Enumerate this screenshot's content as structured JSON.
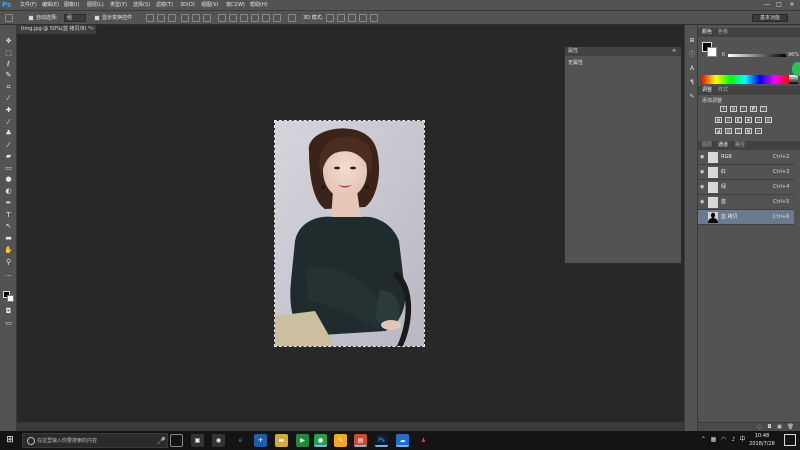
{
  "app": {
    "logo": "Ps"
  },
  "menu": {
    "items": [
      "文件(F)",
      "编辑(E)",
      "图像(I)",
      "图层(L)",
      "类型(Y)",
      "选择(S)",
      "滤镜(T)",
      "3D(D)",
      "视图(V)",
      "窗口(W)",
      "帮助(H)"
    ],
    "min": "—",
    "max": "□",
    "close": "✕"
  },
  "options": {
    "auto_select_label": "自动选择:",
    "auto_select_value": "组",
    "show_transform_label": "显示变换控件",
    "mode_3d_label": "3D 模式:",
    "workspace": "基本功能"
  },
  "document": {
    "tab_label": "timg.jpg @ 50%(蓝 拷贝/8) *",
    "close": "×"
  },
  "properties": {
    "title": "属性",
    "subtitle": "无属性",
    "menu_icon": "≡"
  },
  "color_panel": {
    "tabs": [
      "颜色",
      "色板"
    ],
    "k_label": "K",
    "k_value": "96",
    "unit": "%"
  },
  "adjust_panel": {
    "tabs": [
      "调整",
      "样式"
    ],
    "title": "添加调整"
  },
  "channels_panel": {
    "tabs": [
      "图层",
      "通道",
      "路径"
    ],
    "rows": [
      {
        "name": "RGB",
        "key": "Ctrl+2"
      },
      {
        "name": "红",
        "key": "Ctrl+3"
      },
      {
        "name": "绿",
        "key": "Ctrl+4"
      },
      {
        "name": "蓝",
        "key": "Ctrl+5"
      },
      {
        "name": "蓝 拷贝",
        "key": "Ctrl+6"
      }
    ]
  },
  "taskbar": {
    "search_placeholder": "在这里输入你要搜索的内容",
    "time": "10:48",
    "date": "2018/7/28"
  },
  "colors": {
    "panel_bg": "#535353",
    "canvas_bg": "#282828",
    "selected_row": "#6b7a90",
    "ps_blue": "#31a8ff"
  }
}
